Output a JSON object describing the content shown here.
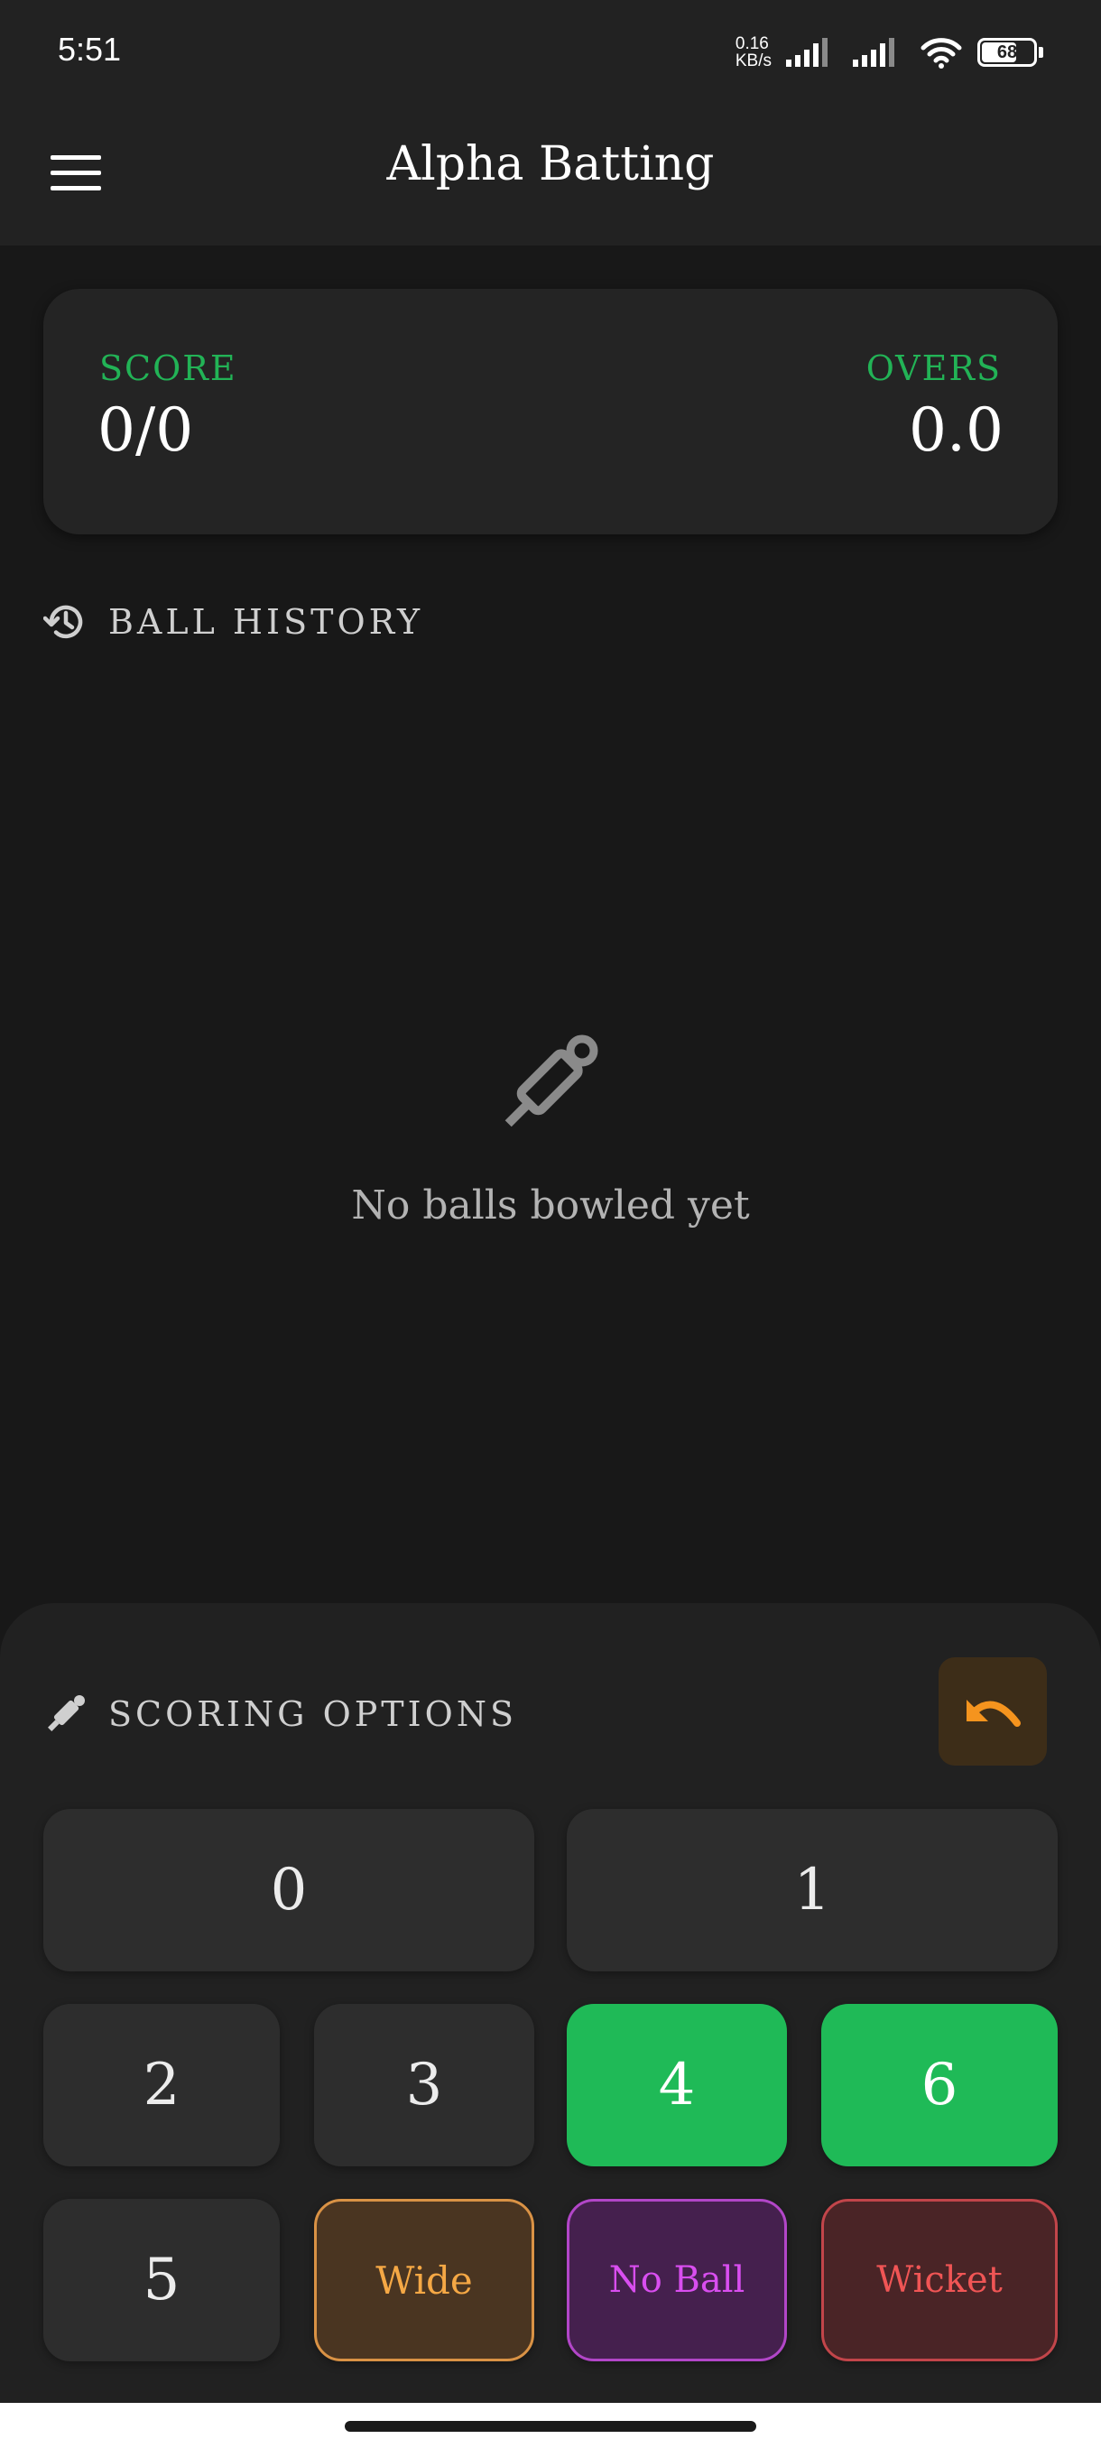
{
  "status_bar": {
    "time": "5:51",
    "net_speed_value": "0.16",
    "net_speed_unit": "KB/s",
    "battery": "68",
    "battery_level": 0.68
  },
  "app_bar": {
    "title": "Alpha Batting"
  },
  "score_card": {
    "score_label": "SCORE",
    "score_value": "0/0",
    "overs_label": "OVERS",
    "overs_value": "0.0",
    "accent_color": "#22b356"
  },
  "ball_history": {
    "title": "BALL HISTORY",
    "empty_text": "No balls bowled yet"
  },
  "scoring_options": {
    "title": "SCORING OPTIONS",
    "undo_icon": "undo-icon",
    "keys": [
      "0",
      "1",
      "2",
      "3",
      "4",
      "6",
      "5",
      "Wide",
      "No Ball",
      "Wicket"
    ],
    "colors": {
      "boundary": "#1fba57",
      "wide": "#f5a845",
      "no_ball": "#d94ef0",
      "wicket": "#f05555",
      "undo": "#f5941e"
    }
  }
}
